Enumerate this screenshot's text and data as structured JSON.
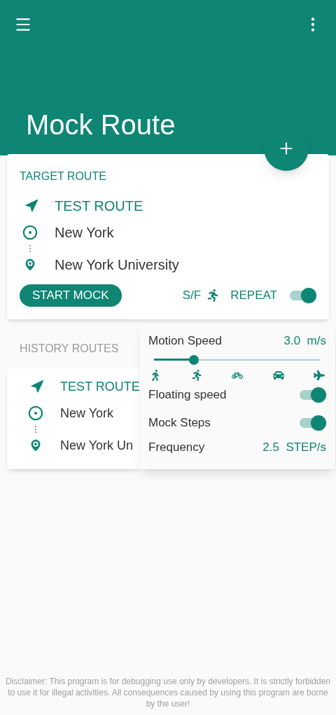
{
  "app_bar": {
    "title": "Mock Route"
  },
  "target_route": {
    "heading": "TARGET ROUTE",
    "name": "TEST ROUTE",
    "start": "New York",
    "end": "New York University",
    "start_button": "START MOCK",
    "sf_label": "S/F",
    "repeat_label": "REPEAT",
    "repeat_on": true
  },
  "history": {
    "heading": "HISTORY ROUTES",
    "routes": [
      {
        "name": "TEST ROUTE",
        "start": "New York",
        "end": "New York Un"
      }
    ]
  },
  "speed_panel": {
    "title": "Motion Speed",
    "value": "3.0  m/s",
    "level": 0.24,
    "modes": [
      {
        "kind": "walk"
      },
      {
        "kind": "run"
      },
      {
        "kind": "bike"
      },
      {
        "kind": "car"
      },
      {
        "kind": "plane"
      }
    ],
    "toggles": [
      {
        "label": "Floating speed",
        "on": true
      },
      {
        "label": "Mock Steps",
        "on": true
      }
    ],
    "frequency_label": "Frequency",
    "frequency_value": "2.5  STEP/s"
  },
  "disclaimer": "Disclaimer: This program is for debugging use only by developers. It is strictly forbidden to use it for illegal activities. All consequences caused by using this program are borne by the user!"
}
